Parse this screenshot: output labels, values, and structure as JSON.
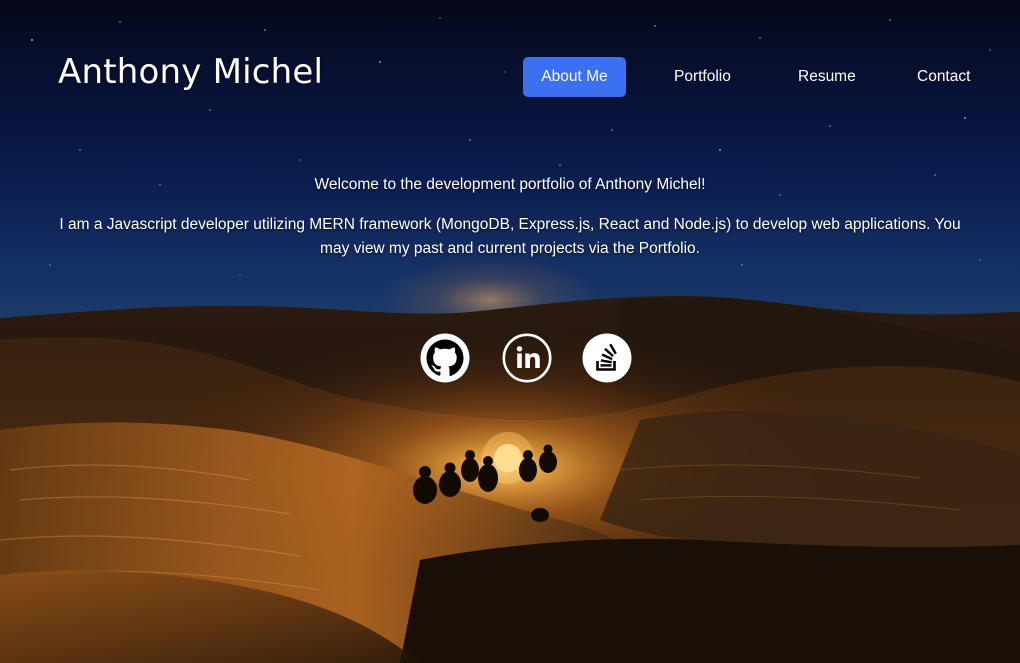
{
  "header": {
    "site_title": "Anthony Michel"
  },
  "nav": {
    "items": [
      {
        "label": "About Me",
        "active": true
      },
      {
        "label": "Portfolio",
        "active": false
      },
      {
        "label": "Resume",
        "active": false
      },
      {
        "label": "Contact",
        "active": false
      }
    ]
  },
  "intro": {
    "welcome": "Welcome to the development portfolio of Anthony Michel!",
    "bio": "I am a Javascript developer utilizing MERN framework (MongoDB, Express.js, React and Node.js) to develop web applications. You may view my past and current projects via the Portfolio."
  },
  "social": {
    "icons": [
      "github-icon",
      "linkedin-icon",
      "stack-overflow-icon"
    ]
  },
  "colors": {
    "accent": "#3b71f0",
    "sky_top": "#050a1e",
    "sand": "#c8762a",
    "fire": "#ffd77a"
  }
}
